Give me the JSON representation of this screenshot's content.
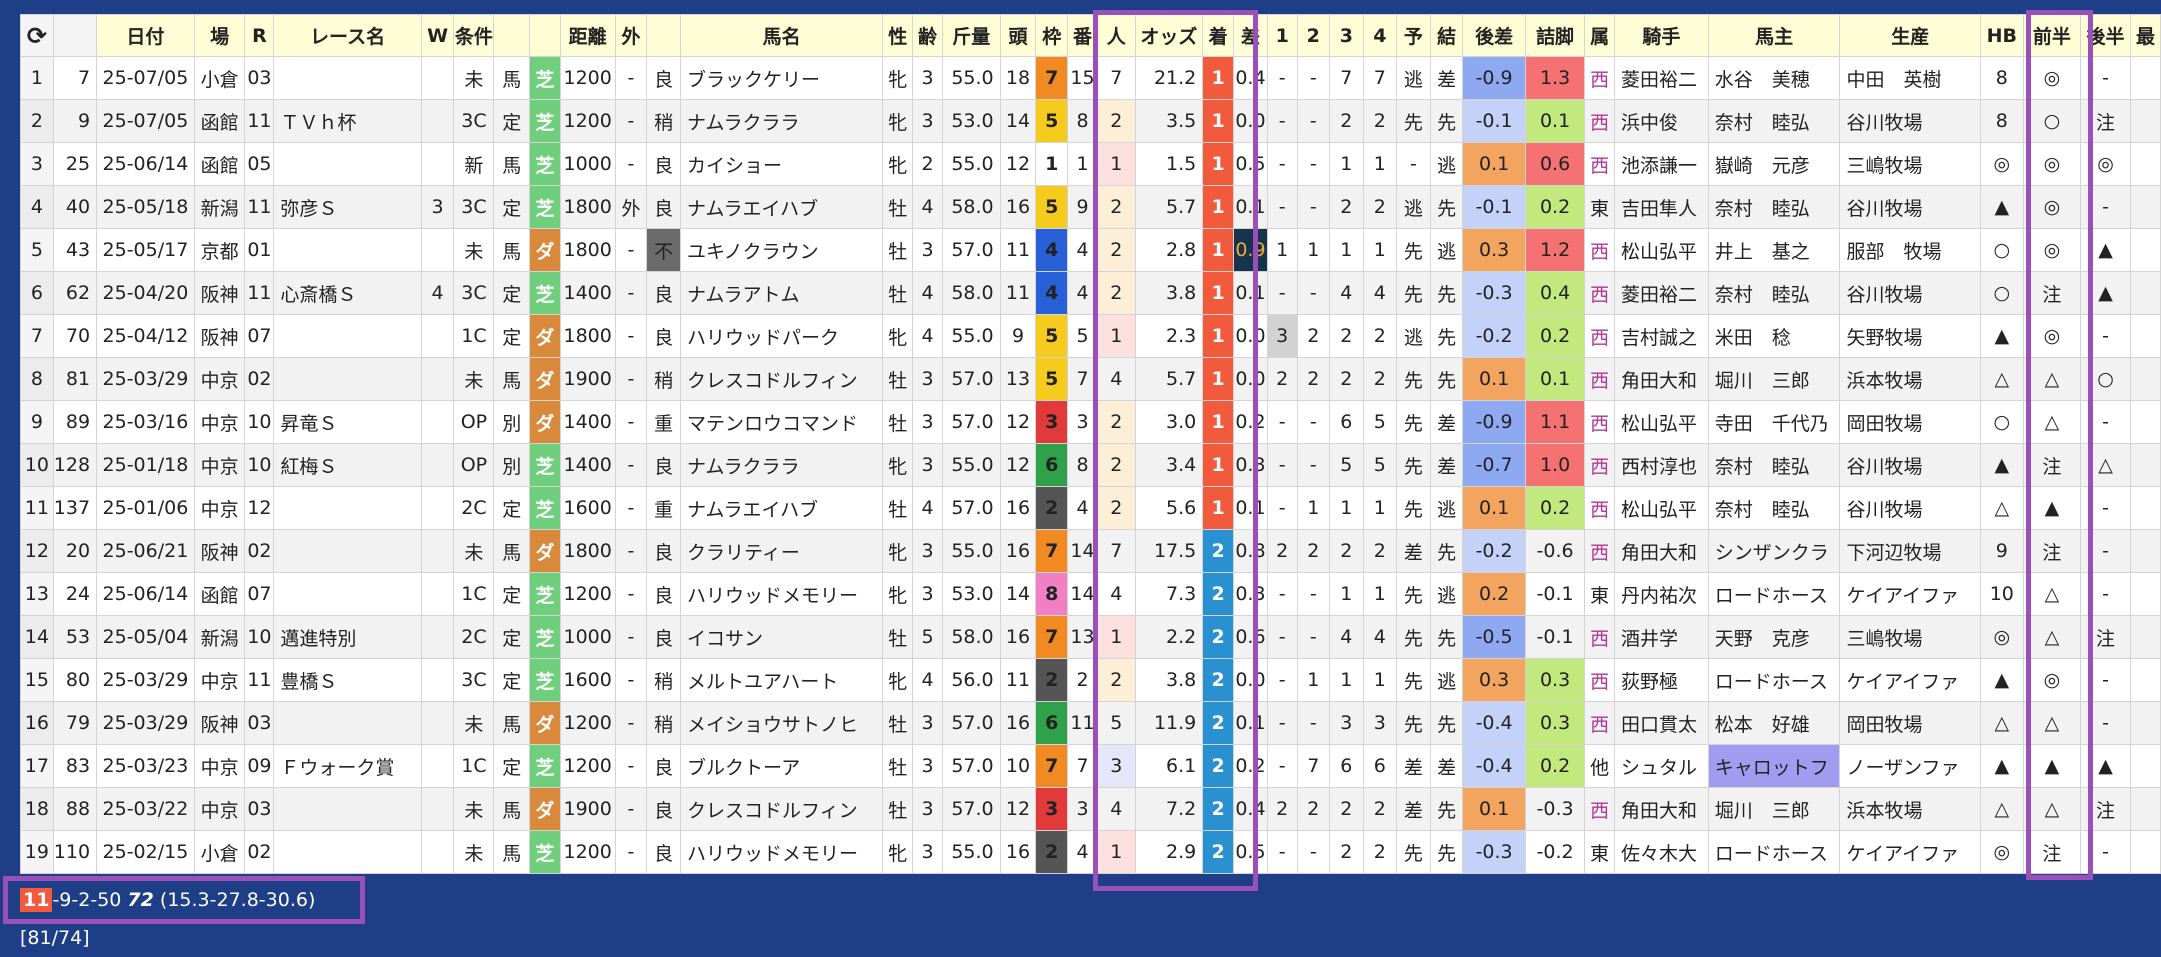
{
  "headers": [
    "",
    "",
    "日付",
    "場",
    "R",
    "レース名",
    "W",
    "条件",
    "",
    "",
    "距離",
    "外",
    "",
    "馬名",
    "性",
    "齢",
    "斤量",
    "頭",
    "枠",
    "番",
    "人",
    "オッズ",
    "着",
    "差",
    "1",
    "2",
    "3",
    "4",
    "予",
    "結",
    "後差",
    "詰脚",
    "属",
    "騎手",
    "馬主",
    "生産",
    "HB",
    "前半",
    "後半",
    "最"
  ],
  "refresh_icon": "refresh-icon",
  "rows": [
    [
      "1",
      "7",
      "25-07/05",
      "小倉",
      "03",
      "",
      "",
      "未",
      "馬",
      "芝",
      "1200",
      "-",
      "良",
      "ブラックケリー",
      "牝",
      "3",
      "55.0",
      "18",
      "7",
      "15",
      "7",
      "21.2",
      "1",
      "0.4",
      "-",
      "-",
      "7",
      "7",
      "逃",
      "差",
      "-0.9",
      "1.3",
      "西",
      "菱田裕二",
      "水谷　美穂",
      "中田　英樹",
      "8",
      "◎",
      "-",
      ""
    ],
    [
      "2",
      "9",
      "25-07/05",
      "函館",
      "11",
      "ＴＶｈ杯",
      "",
      "3C",
      "定",
      "芝",
      "1200",
      "-",
      "稍",
      "ナムラクララ",
      "牝",
      "3",
      "53.0",
      "14",
      "5",
      "8",
      "2",
      "3.5",
      "1",
      "0.0",
      "-",
      "-",
      "2",
      "2",
      "先",
      "先",
      "-0.1",
      "0.1",
      "西",
      "浜中俊",
      "奈村　睦弘",
      "谷川牧場",
      "8",
      "○",
      "注",
      ""
    ],
    [
      "3",
      "25",
      "25-06/14",
      "函館",
      "05",
      "",
      "",
      "新",
      "馬",
      "芝",
      "1000",
      "-",
      "良",
      "カイショー",
      "牝",
      "2",
      "55.0",
      "12",
      "1",
      "1",
      "1",
      "1.5",
      "1",
      "0.5",
      "-",
      "-",
      "1",
      "1",
      "-",
      "逃",
      "0.1",
      "0.6",
      "西",
      "池添謙一",
      "嶽崎　元彦",
      "三嶋牧場",
      "◎",
      "◎",
      "◎",
      ""
    ],
    [
      "4",
      "40",
      "25-05/18",
      "新潟",
      "11",
      "弥彦Ｓ",
      "3",
      "3C",
      "定",
      "芝",
      "1800",
      "外",
      "良",
      "ナムラエイハブ",
      "牡",
      "4",
      "58.0",
      "16",
      "5",
      "9",
      "2",
      "5.7",
      "1",
      "0.1",
      "-",
      "-",
      "2",
      "2",
      "逃",
      "先",
      "-0.1",
      "0.2",
      "東",
      "吉田隼人",
      "奈村　睦弘",
      "谷川牧場",
      "▲",
      "◎",
      "-",
      ""
    ],
    [
      "5",
      "43",
      "25-05/17",
      "京都",
      "01",
      "",
      "",
      "未",
      "馬",
      "ダ",
      "1800",
      "-",
      "不",
      "ユキノクラウン",
      "牡",
      "3",
      "57.0",
      "11",
      "4",
      "4",
      "2",
      "2.8",
      "1",
      "0.9",
      "1",
      "1",
      "1",
      "1",
      "先",
      "逃",
      "0.3",
      "1.2",
      "西",
      "松山弘平",
      "井上　基之",
      "服部　牧場",
      "○",
      "◎",
      "▲",
      ""
    ],
    [
      "6",
      "62",
      "25-04/20",
      "阪神",
      "11",
      "心斎橋Ｓ",
      "4",
      "3C",
      "定",
      "芝",
      "1400",
      "-",
      "良",
      "ナムラアトム",
      "牡",
      "4",
      "58.0",
      "11",
      "4",
      "4",
      "2",
      "3.8",
      "1",
      "0.1",
      "-",
      "-",
      "4",
      "4",
      "先",
      "先",
      "-0.3",
      "0.4",
      "西",
      "菱田裕二",
      "奈村　睦弘",
      "谷川牧場",
      "○",
      "注",
      "▲",
      ""
    ],
    [
      "7",
      "70",
      "25-04/12",
      "阪神",
      "07",
      "",
      "",
      "1C",
      "定",
      "ダ",
      "1800",
      "-",
      "良",
      "ハリウッドパーク",
      "牝",
      "4",
      "55.0",
      "9",
      "5",
      "5",
      "1",
      "2.3",
      "1",
      "0.0",
      "3",
      "2",
      "2",
      "2",
      "逃",
      "先",
      "-0.2",
      "0.2",
      "西",
      "吉村誠之",
      "米田　稔",
      "矢野牧場",
      "▲",
      "◎",
      "-",
      ""
    ],
    [
      "8",
      "81",
      "25-03/29",
      "中京",
      "02",
      "",
      "",
      "未",
      "馬",
      "ダ",
      "1900",
      "-",
      "稍",
      "クレスコドルフィン",
      "牡",
      "3",
      "57.0",
      "13",
      "5",
      "7",
      "4",
      "5.7",
      "1",
      "0.0",
      "2",
      "2",
      "2",
      "2",
      "先",
      "先",
      "0.1",
      "0.1",
      "西",
      "角田大和",
      "堀川　三郎",
      "浜本牧場",
      "△",
      "△",
      "○",
      ""
    ],
    [
      "9",
      "89",
      "25-03/16",
      "中京",
      "10",
      "昇竜Ｓ",
      "",
      "OP",
      "別",
      "ダ",
      "1400",
      "-",
      "重",
      "マテンロウコマンド",
      "牡",
      "3",
      "57.0",
      "12",
      "3",
      "3",
      "2",
      "3.0",
      "1",
      "0.2",
      "-",
      "-",
      "6",
      "5",
      "先",
      "差",
      "-0.9",
      "1.1",
      "西",
      "松山弘平",
      "寺田　千代乃",
      "岡田牧場",
      "○",
      "△",
      "-",
      ""
    ],
    [
      "10",
      "128",
      "25-01/18",
      "中京",
      "10",
      "紅梅Ｓ",
      "",
      "OP",
      "別",
      "芝",
      "1400",
      "-",
      "良",
      "ナムラクララ",
      "牝",
      "3",
      "55.0",
      "12",
      "6",
      "8",
      "2",
      "3.4",
      "1",
      "0.3",
      "-",
      "-",
      "5",
      "5",
      "先",
      "差",
      "-0.7",
      "1.0",
      "西",
      "西村淳也",
      "奈村　睦弘",
      "谷川牧場",
      "▲",
      "注",
      "△",
      ""
    ],
    [
      "11",
      "137",
      "25-01/06",
      "中京",
      "12",
      "",
      "",
      "2C",
      "定",
      "芝",
      "1600",
      "-",
      "重",
      "ナムラエイハブ",
      "牡",
      "4",
      "57.0",
      "16",
      "2",
      "4",
      "2",
      "5.6",
      "1",
      "0.1",
      "-",
      "1",
      "1",
      "1",
      "先",
      "逃",
      "0.1",
      "0.2",
      "西",
      "松山弘平",
      "奈村　睦弘",
      "谷川牧場",
      "△",
      "▲",
      "-",
      ""
    ],
    [
      "12",
      "20",
      "25-06/21",
      "阪神",
      "02",
      "",
      "",
      "未",
      "馬",
      "ダ",
      "1800",
      "-",
      "良",
      "クラリティー",
      "牝",
      "3",
      "55.0",
      "16",
      "7",
      "14",
      "7",
      "17.5",
      "2",
      "0.8",
      "2",
      "2",
      "2",
      "2",
      "差",
      "先",
      "-0.2",
      "-0.6",
      "西",
      "角田大和",
      "シンザンクラ",
      "下河辺牧場",
      "9",
      "注",
      "-",
      ""
    ],
    [
      "13",
      "24",
      "25-06/14",
      "函館",
      "07",
      "",
      "",
      "1C",
      "定",
      "芝",
      "1200",
      "-",
      "良",
      "ハリウッドメモリー",
      "牝",
      "3",
      "53.0",
      "14",
      "8",
      "14",
      "4",
      "7.3",
      "2",
      "0.3",
      "-",
      "-",
      "1",
      "1",
      "先",
      "逃",
      "0.2",
      "-0.1",
      "東",
      "丹内祐次",
      "ロードホース",
      "ケイアイファ",
      "10",
      "△",
      "-",
      ""
    ],
    [
      "14",
      "53",
      "25-05/04",
      "新潟",
      "10",
      "邁進特別",
      "",
      "2C",
      "定",
      "芝",
      "1000",
      "-",
      "良",
      "イコサン",
      "牡",
      "5",
      "58.0",
      "16",
      "7",
      "13",
      "1",
      "2.2",
      "2",
      "0.6",
      "-",
      "-",
      "4",
      "4",
      "先",
      "先",
      "-0.5",
      "-0.1",
      "西",
      "酒井学",
      "天野　克彦",
      "三嶋牧場",
      "◎",
      "△",
      "注",
      ""
    ],
    [
      "15",
      "80",
      "25-03/29",
      "中京",
      "11",
      "豊橋Ｓ",
      "",
      "3C",
      "定",
      "芝",
      "1600",
      "-",
      "稍",
      "メルトユアハート",
      "牝",
      "4",
      "56.0",
      "11",
      "2",
      "2",
      "2",
      "3.8",
      "2",
      "0.0",
      "-",
      "1",
      "1",
      "1",
      "先",
      "逃",
      "0.3",
      "0.3",
      "西",
      "荻野極",
      "ロードホース",
      "ケイアイファ",
      "▲",
      "◎",
      "-",
      ""
    ],
    [
      "16",
      "79",
      "25-03/29",
      "阪神",
      "03",
      "",
      "",
      "未",
      "馬",
      "ダ",
      "1200",
      "-",
      "稍",
      "メイショウサトノヒ",
      "牡",
      "3",
      "57.0",
      "16",
      "6",
      "11",
      "5",
      "11.9",
      "2",
      "0.1",
      "-",
      "-",
      "3",
      "3",
      "先",
      "先",
      "-0.4",
      "0.3",
      "西",
      "田口貫太",
      "松本　好雄",
      "岡田牧場",
      "△",
      "△",
      "-",
      ""
    ],
    [
      "17",
      "83",
      "25-03/23",
      "中京",
      "09",
      "Ｆウォーク賞",
      "",
      "1C",
      "定",
      "芝",
      "1200",
      "-",
      "良",
      "ブルクトーア",
      "牡",
      "3",
      "57.0",
      "10",
      "7",
      "7",
      "3",
      "6.1",
      "2",
      "0.2",
      "-",
      "7",
      "6",
      "6",
      "差",
      "差",
      "-0.4",
      "0.2",
      "他",
      "シュタル",
      "キャロットフ",
      "ノーザンファ",
      "▲",
      "▲",
      "▲",
      ""
    ],
    [
      "18",
      "88",
      "25-03/22",
      "中京",
      "03",
      "",
      "",
      "未",
      "馬",
      "ダ",
      "1900",
      "-",
      "良",
      "クレスコドルフィン",
      "牡",
      "3",
      "57.0",
      "12",
      "3",
      "3",
      "4",
      "7.2",
      "2",
      "0.4",
      "2",
      "2",
      "2",
      "2",
      "差",
      "先",
      "0.1",
      "-0.3",
      "西",
      "角田大和",
      "堀川　三郎",
      "浜本牧場",
      "△",
      "△",
      "注",
      ""
    ],
    [
      "19",
      "110",
      "25-02/15",
      "小倉",
      "02",
      "",
      "",
      "未",
      "馬",
      "芝",
      "1200",
      "-",
      "良",
      "ハリウッドメモリー",
      "牝",
      "3",
      "55.0",
      "16",
      "2",
      "4",
      "1",
      "2.9",
      "2",
      "0.5",
      "-",
      "-",
      "2",
      "2",
      "先",
      "先",
      "-0.3",
      "-0.2",
      "東",
      "佐々木大",
      "ロードホース",
      "ケイアイファ",
      "◎",
      "注",
      "-",
      ""
    ]
  ],
  "status": {
    "first": "11",
    "record": "-9-2-50",
    "bold": "72",
    "rates": "(15.3-27.8-30.6)",
    "counts": "[81/74]"
  },
  "colors": {
    "background": "#1e3f87",
    "highlight_border": "#9b4fb8",
    "first_place": "#f15a3c",
    "second_place": "#2a91d0",
    "turf": "#6fcf7c",
    "dirt": "#d9893c"
  }
}
